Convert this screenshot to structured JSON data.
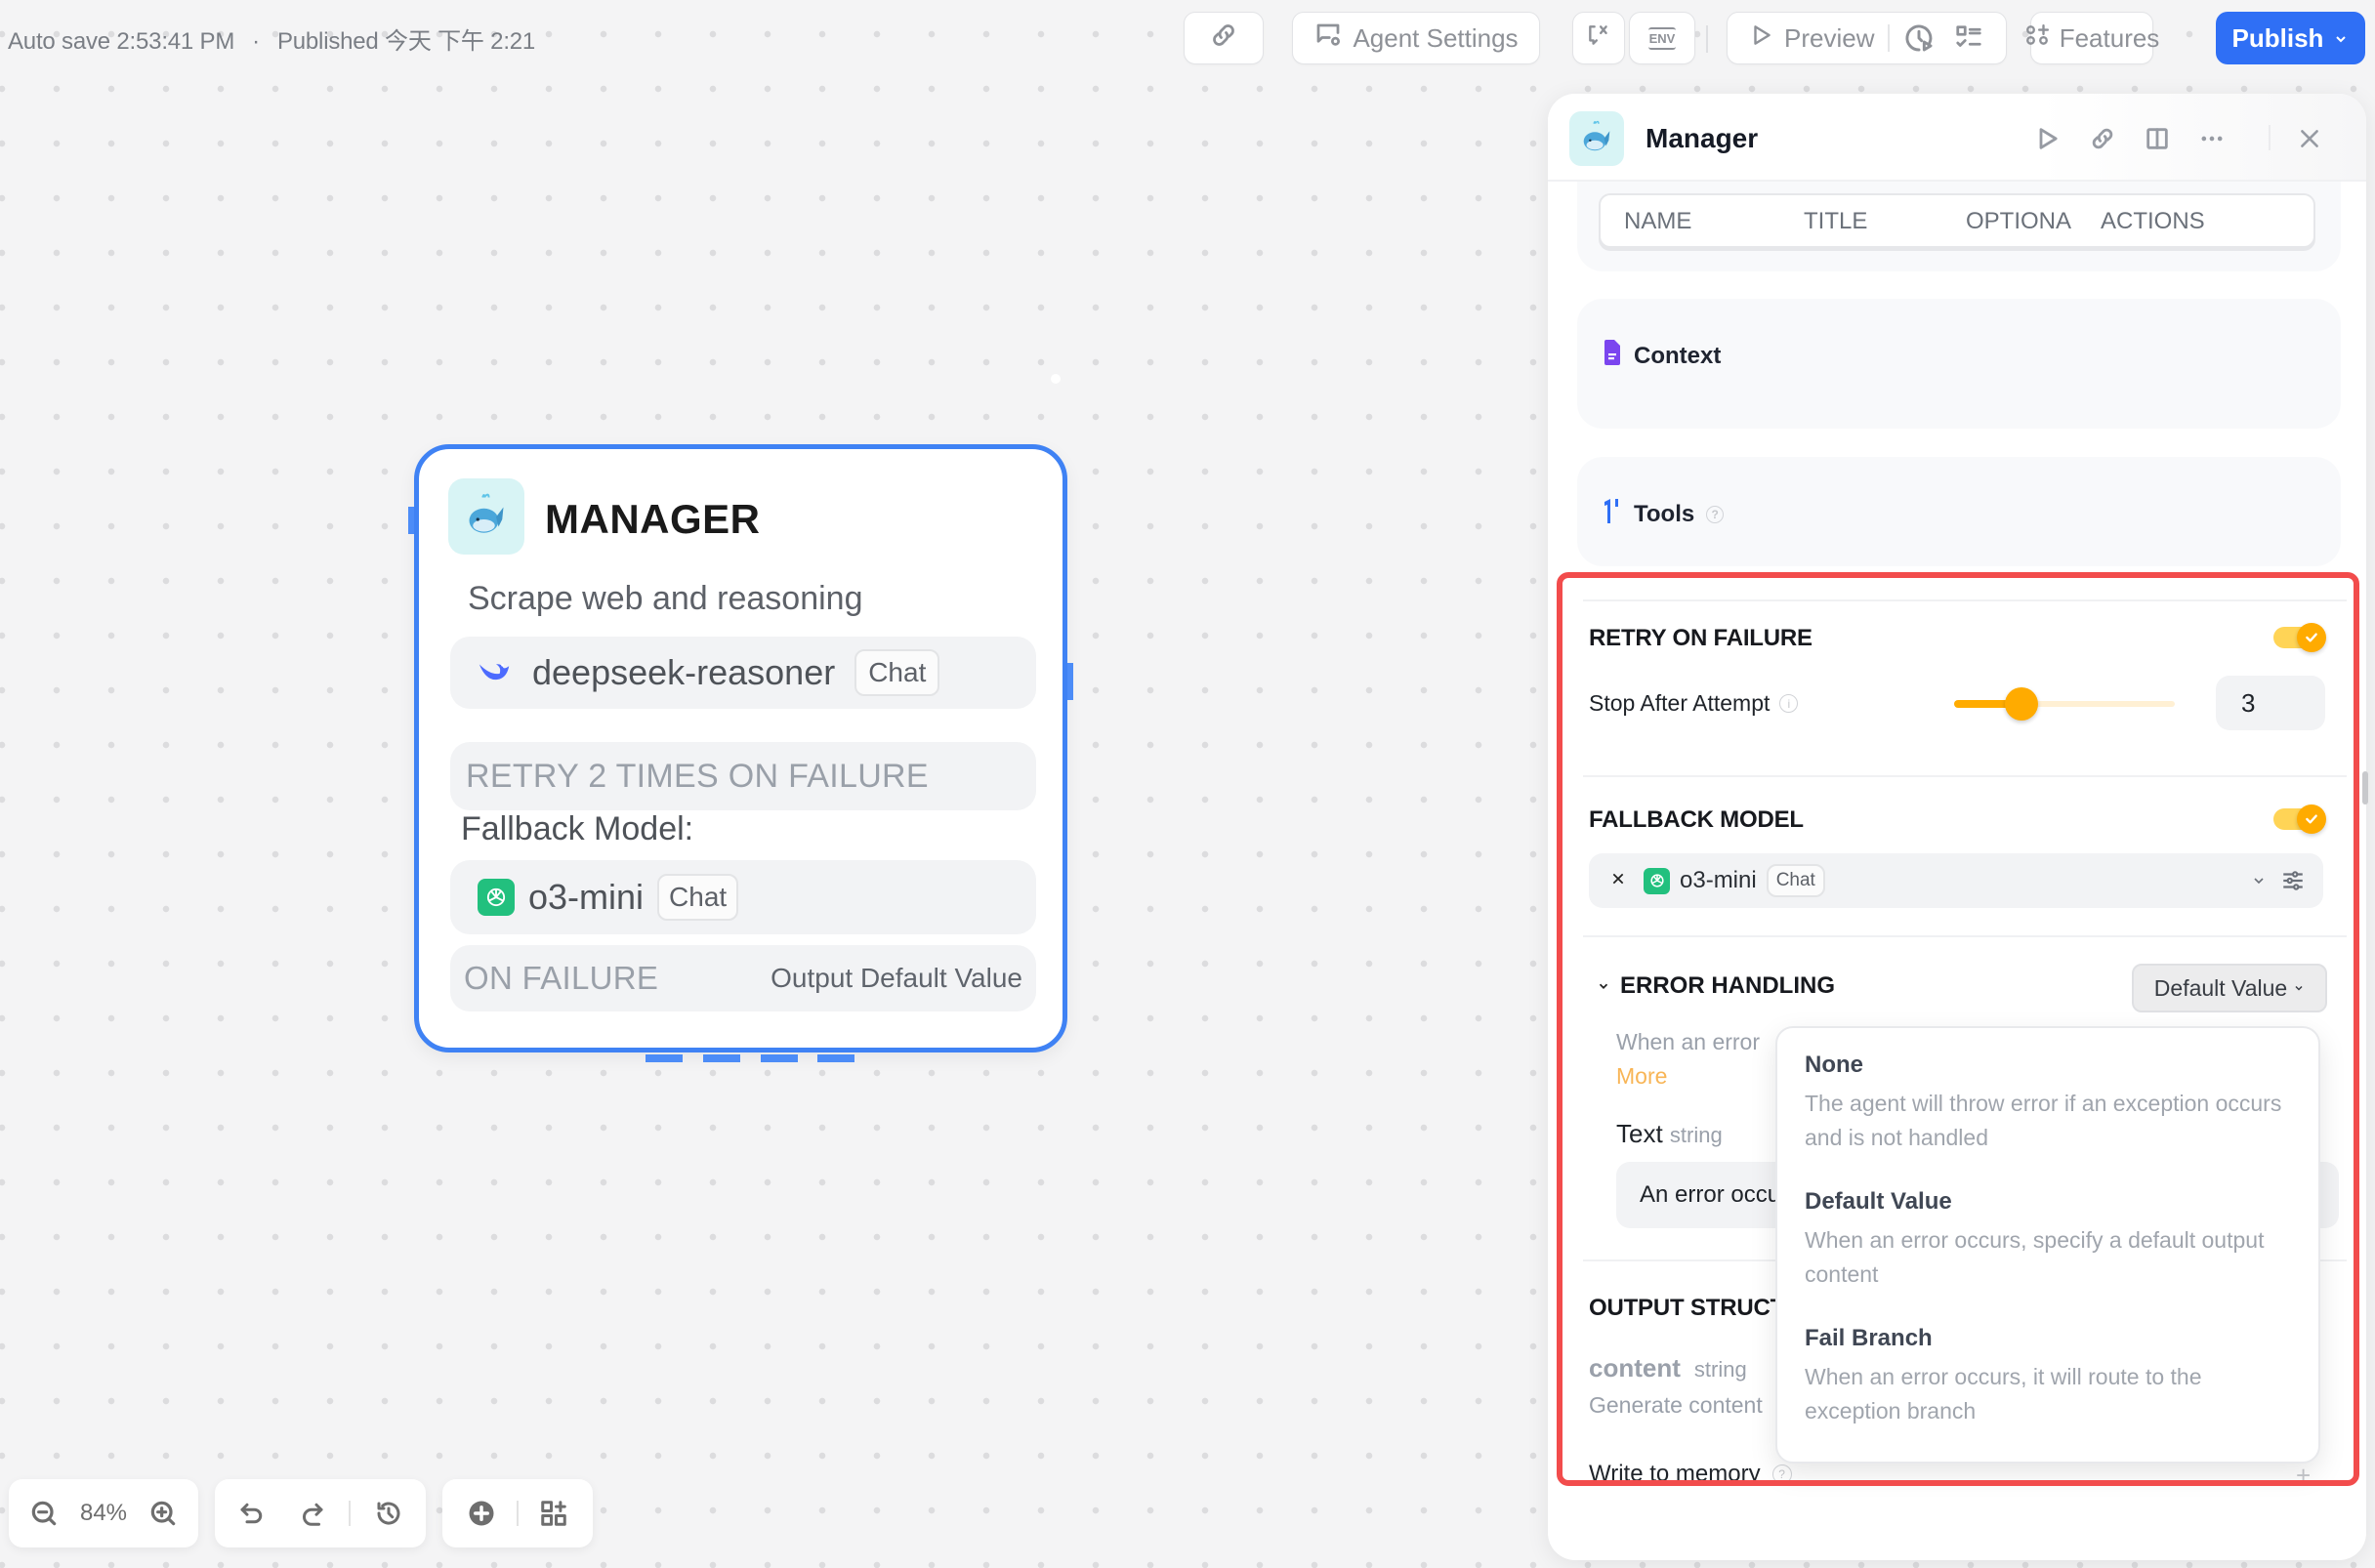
{
  "topbar": {
    "autosave": "Auto save 2:53:41 PM",
    "separator": "·",
    "published": "Published 今天 下午 2:21",
    "buttons": {
      "share_icon": "link-icon",
      "agent_settings": "Agent Settings",
      "variables_icon": "chat-variable-icon",
      "env_icon": "env-icon",
      "env_label": "ENV",
      "preview": "Preview",
      "history_run_icon": "clock-play-icon",
      "checklist_icon": "checklist-icon",
      "features": "Features",
      "publish": "Publish"
    }
  },
  "node": {
    "title": "MANAGER",
    "avatar": "whale-emoji",
    "description": "Scrape web and reasoning",
    "model": {
      "name": "deepseek-reasoner",
      "badge": "Chat",
      "icon": "deepseek-icon"
    },
    "retry_text": "RETRY 2 TIMES ON FAILURE",
    "fallback_label": "Fallback Model:",
    "fallback_model": {
      "name": "o3-mini",
      "badge": "Chat",
      "icon": "openai-icon"
    },
    "on_failure_label": "ON FAILURE",
    "on_failure_value": "Output Default Value",
    "selected": true
  },
  "panel": {
    "title": "Manager",
    "header_icons": [
      "play-icon",
      "link-icon",
      "book-icon",
      "more-icon",
      "close-icon"
    ],
    "table_columns": [
      "NAME",
      "TITLE",
      "OPTIONA",
      "ACTIONS"
    ],
    "context_title": "Context",
    "tools_title": "Tools",
    "retry": {
      "title": "RETRY ON FAILURE",
      "enabled": true,
      "stop_after_label": "Stop After Attempt",
      "attempts": "3",
      "slider_fraction": 0.24
    },
    "fallback": {
      "title": "FALLBACK MODEL",
      "enabled": true,
      "model": "o3-mini",
      "badge": "Chat"
    },
    "error_handling": {
      "title": "ERROR HANDLING",
      "selected": "Default Value",
      "help_text": "When an error",
      "more_link": "More",
      "field_label": "Text",
      "field_type": "string",
      "field_value": "An error occu",
      "options": [
        {
          "title": "None",
          "description": "The agent will throw error if an exception occurs and is not handled"
        },
        {
          "title": "Default Value",
          "description": "When an error occurs, specify a default output content"
        },
        {
          "title": "Fail Branch",
          "description": "When an error occurs, it will route to the exception branch"
        }
      ]
    },
    "output_structure": {
      "title": "OUTPUT STRUCT",
      "var_name": "content",
      "var_type": "string",
      "var_desc": "Generate content"
    },
    "write_memory": "Write to memory"
  },
  "bottom_toolbar": {
    "zoom_level": "84%"
  },
  "colors": {
    "accent_blue": "#2f6ff5",
    "node_border": "#3f82f4",
    "toggle_orange": "#ffab00",
    "highlight_red": "#f24c4c",
    "more_link": "#f8b556"
  }
}
